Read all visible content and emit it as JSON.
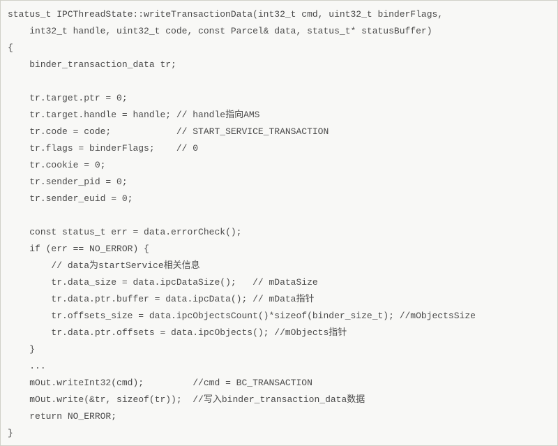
{
  "code": {
    "lines": [
      "status_t IPCThreadState::writeTransactionData(int32_t cmd, uint32_t binderFlags,",
      "    int32_t handle, uint32_t code, const Parcel& data, status_t* statusBuffer)",
      "{",
      "    binder_transaction_data tr;",
      "",
      "    tr.target.ptr = 0;",
      "    tr.target.handle = handle; // handle指向AMS",
      "    tr.code = code;            // START_SERVICE_TRANSACTION",
      "    tr.flags = binderFlags;    // 0",
      "    tr.cookie = 0;",
      "    tr.sender_pid = 0;",
      "    tr.sender_euid = 0;",
      "",
      "    const status_t err = data.errorCheck();",
      "    if (err == NO_ERROR) {",
      "        // data为startService相关信息",
      "        tr.data_size = data.ipcDataSize();   // mDataSize",
      "        tr.data.ptr.buffer = data.ipcData(); // mData指针",
      "        tr.offsets_size = data.ipcObjectsCount()*sizeof(binder_size_t); //mObjectsSize",
      "        tr.data.ptr.offsets = data.ipcObjects(); //mObjects指针",
      "    }",
      "    ...",
      "    mOut.writeInt32(cmd);         //cmd = BC_TRANSACTION",
      "    mOut.write(&tr, sizeof(tr));  //写入binder_transaction_data数据",
      "    return NO_ERROR;",
      "}"
    ]
  }
}
